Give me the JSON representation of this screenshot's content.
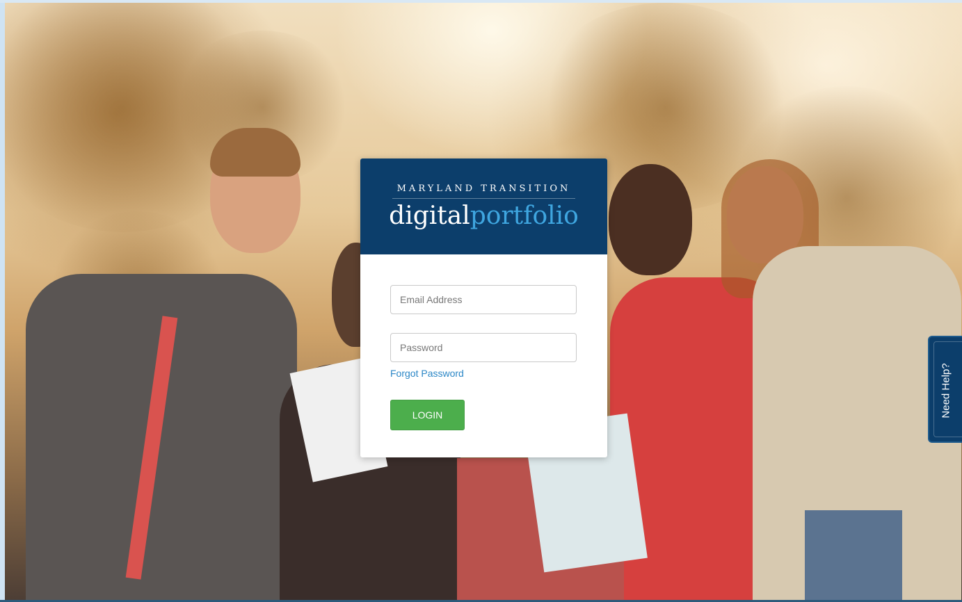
{
  "brand": {
    "top_line": "MARYLAND TRANSITION",
    "word1": "digital",
    "word2": "portfolio"
  },
  "login": {
    "email_placeholder": "Email Address",
    "password_placeholder": "Password",
    "forgot_label": "Forgot Password",
    "login_label": "LOGIN"
  },
  "help": {
    "label": "Need Help?"
  },
  "colors": {
    "header": "#0c3e6b",
    "accent_blue": "#3fa6e0",
    "link": "#2a86c6",
    "login_button": "#4cae4c"
  }
}
